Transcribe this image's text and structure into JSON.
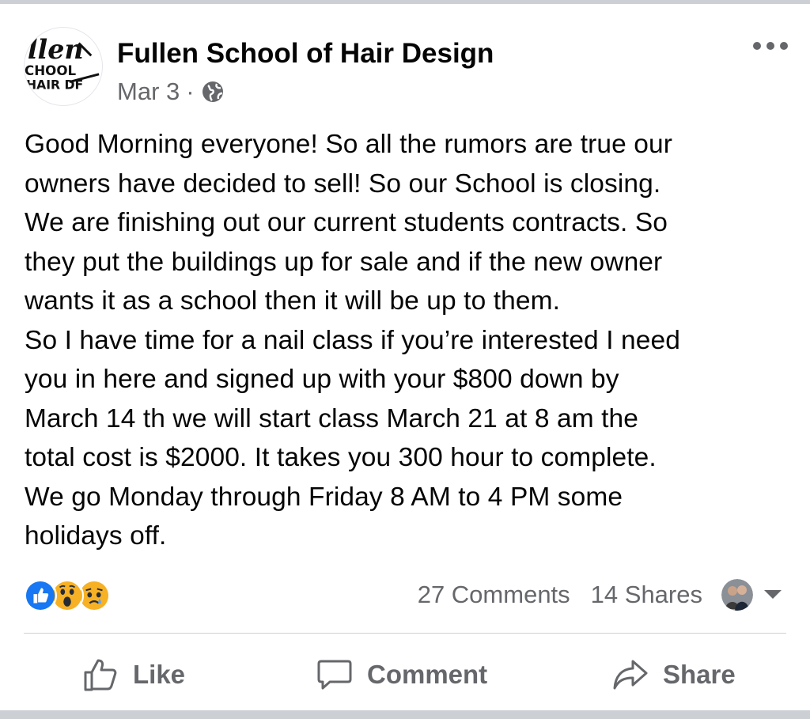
{
  "post": {
    "page_name": "Fullen School of Hair Design",
    "date": "Mar 3",
    "separator": "·",
    "privacy_icon": "globe-icon",
    "body": "Good Morning everyone! So all the rumors are true our\nowners have decided to sell! So our School is closing.\nWe are finishing out our current students contracts.  So\nthey put the buildings up for sale and if the new owner\nwants it as a  school then it will be up to them.\n   So I have time for a nail class if you’re interested I need\nyou in here and signed up with your $800 down by\nMarch 14 th  we will start class March 21 at 8 am the\ntotal cost is $2000. It takes you 300 hour to complete.\nWe go Monday through Friday 8 AM to 4 PM  some\nholidays off."
  },
  "logo": {
    "line1": "llen",
    "line2": "CHOOL",
    "line3": "HAIR DF"
  },
  "stats": {
    "reactions": [
      "like-reaction-icon",
      "wow-reaction-icon",
      "sad-reaction-icon"
    ],
    "comments": "27 Comments",
    "shares": "14 Shares"
  },
  "actions": {
    "like": "Like",
    "comment": "Comment",
    "share": "Share"
  },
  "colors": {
    "accent": "#1877f2",
    "secondary_text": "#65676b",
    "reaction_yellow": "#f7b125"
  }
}
